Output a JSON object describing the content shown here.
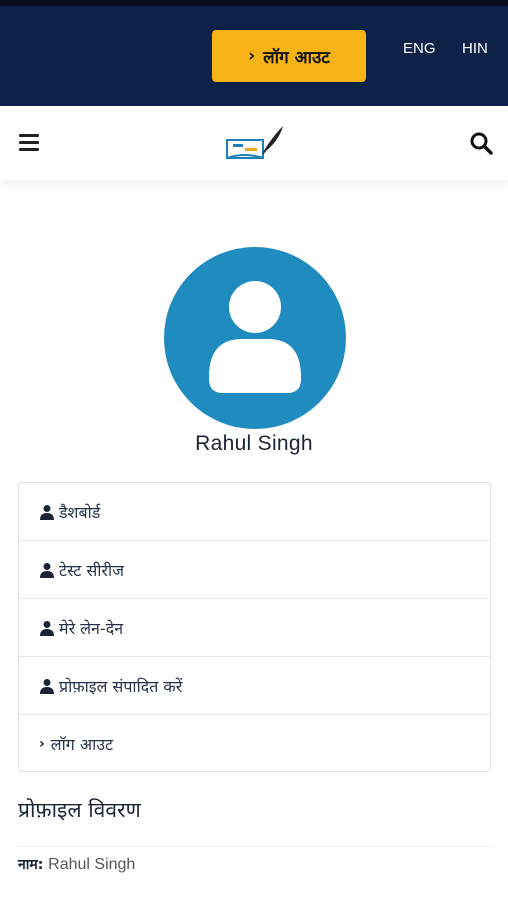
{
  "header": {
    "logout_label": "लॉग आउट",
    "lang_en": "ENG",
    "lang_hi": "HIN"
  },
  "icons": {
    "menu": "hamburger-icon",
    "search": "search-icon",
    "user": "user-icon",
    "chevron": "chevron-right-icon"
  },
  "colors": {
    "topbar": "#0e2248",
    "accent": "#f8b417",
    "avatar": "#1f8bbf"
  },
  "profile": {
    "name": "Rahul Singh"
  },
  "menu": {
    "items": [
      {
        "label": "डैशबोर्ड",
        "icon": "user-icon"
      },
      {
        "label": "टेस्ट सीरीज",
        "icon": "user-icon"
      },
      {
        "label": "मेरे लेन-देन",
        "icon": "user-icon"
      },
      {
        "label": "प्रोफ़ाइल संपादित करें",
        "icon": "user-icon"
      },
      {
        "label": "लॉग आउट",
        "icon": "chevron-right-icon"
      }
    ]
  },
  "details": {
    "title": "प्रोफ़ाइल विवरण",
    "name_key": "नाम:",
    "name_value": "Rahul Singh"
  }
}
